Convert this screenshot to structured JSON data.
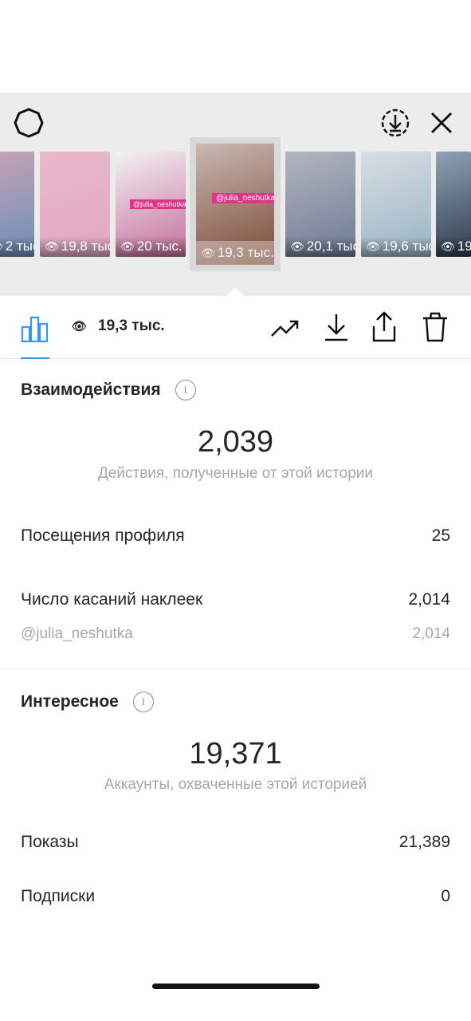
{
  "header": {
    "settings_icon": "gear-icon",
    "download_all_icon": "download-circle-icon",
    "close_icon": "close-icon"
  },
  "stories": [
    {
      "views": "2 тыс.",
      "colors": [
        "#c9a3b5",
        "#6b8fb9"
      ]
    },
    {
      "views": "19,8 тыс.",
      "colors": [
        "#e7b8cb",
        "#e3a9c0"
      ]
    },
    {
      "views": "20 тыс.",
      "colors": [
        "#f2f2f2",
        "#c76f9d"
      ]
    },
    {
      "views": "19,3 тыс.",
      "colors": [
        "#c9b9b4",
        "#7b4a35"
      ]
    },
    {
      "views": "20,1 тыс.",
      "colors": [
        "#b3b6be",
        "#6e7a97"
      ]
    },
    {
      "views": "19,6 тыс.",
      "colors": [
        "#d8dee3",
        "#9ab4c6"
      ]
    },
    {
      "views": "19",
      "colors": [
        "#8fa3b6",
        "#2f3c4d"
      ]
    }
  ],
  "stories_labels": {
    "tag": "@julia_neshutka"
  },
  "toolbar": {
    "views_total": "19,3 тыс."
  },
  "interactions": {
    "title": "Взаимодействия",
    "total": "2,039",
    "subtitle": "Действия, полученные от этой истории",
    "profile_visits_label": "Посещения профиля",
    "profile_visits_value": "25",
    "sticker_taps_label": "Число касаний наклеек",
    "sticker_taps_value": "2,014",
    "sticker_account": "@julia_neshutka",
    "sticker_account_value": "2,014"
  },
  "discovery": {
    "title": "Интересное",
    "total": "19,371",
    "subtitle": "Аккаунты, охваченные этой историей",
    "impressions_label": "Показы",
    "impressions_value": "21,389",
    "follows_label": "Подписки",
    "follows_value": "0"
  },
  "colors": {
    "accent": "#3897f0",
    "text": "#262626",
    "muted": "#a8a8a8"
  }
}
